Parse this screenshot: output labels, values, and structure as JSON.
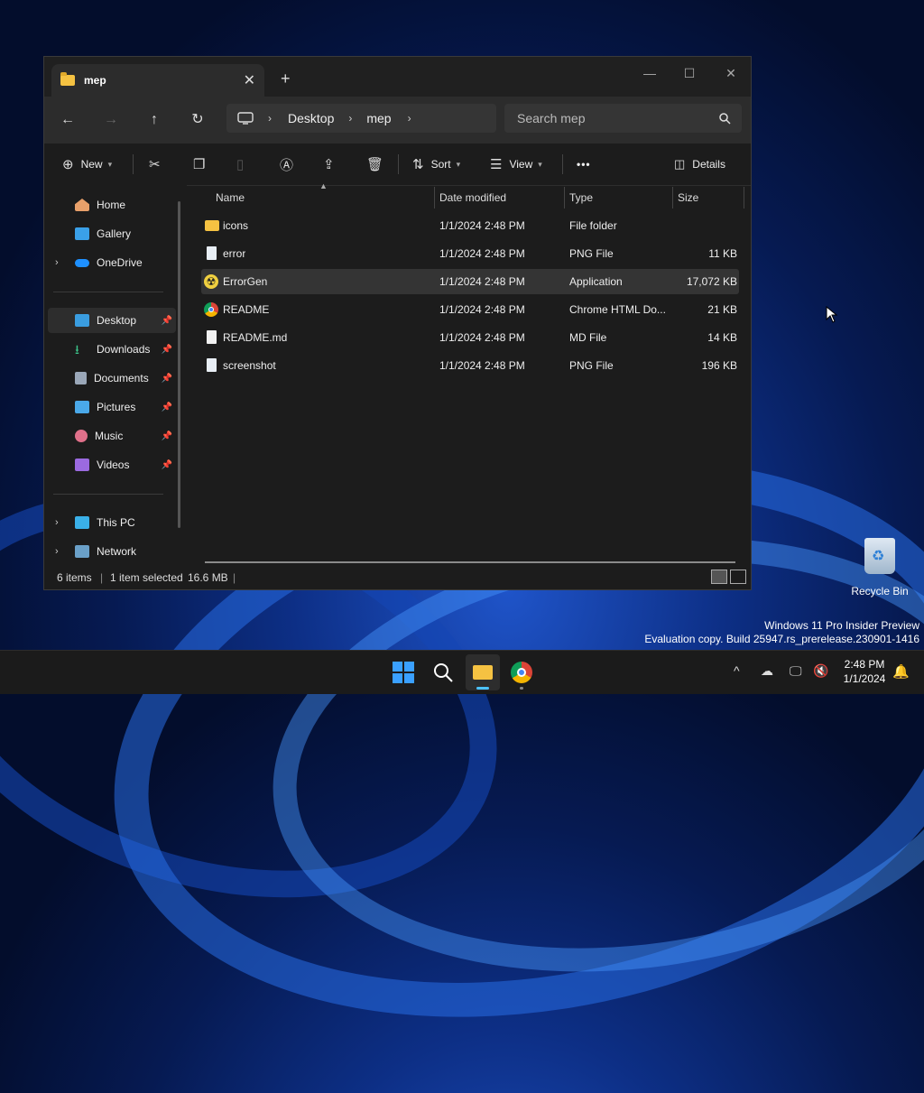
{
  "window": {
    "tab_title": "mep",
    "new_tab": "+",
    "close_tab": "✕",
    "controls": {
      "minimize": "—",
      "maximize": "☐",
      "close": "✕"
    }
  },
  "address": {
    "crumbs": [
      "Desktop",
      "mep"
    ],
    "search_placeholder": "Search mep"
  },
  "commands": {
    "new": "New",
    "sort": "Sort",
    "view": "View",
    "more": "•••",
    "details": "Details"
  },
  "nav": {
    "items": [
      {
        "label": "Home"
      },
      {
        "label": "Gallery"
      },
      {
        "label": "OneDrive"
      },
      {
        "label": "Desktop"
      },
      {
        "label": "Downloads"
      },
      {
        "label": "Documents"
      },
      {
        "label": "Pictures"
      },
      {
        "label": "Music"
      },
      {
        "label": "Videos"
      },
      {
        "label": "This PC"
      },
      {
        "label": "Network"
      }
    ]
  },
  "columns": [
    "Name",
    "Date modified",
    "Type",
    "Size"
  ],
  "files": [
    {
      "name": "icons",
      "date": "1/1/2024 2:48 PM",
      "type": "File folder",
      "size": ""
    },
    {
      "name": "error",
      "date": "1/1/2024 2:48 PM",
      "type": "PNG File",
      "size": "11 KB"
    },
    {
      "name": "ErrorGen",
      "date": "1/1/2024 2:48 PM",
      "type": "Application",
      "size": "17,072 KB"
    },
    {
      "name": "README",
      "date": "1/1/2024 2:48 PM",
      "type": "Chrome HTML Do...",
      "size": "21 KB"
    },
    {
      "name": "README.md",
      "date": "1/1/2024 2:48 PM",
      "type": "MD File",
      "size": "14 KB"
    },
    {
      "name": "screenshot",
      "date": "1/1/2024 2:48 PM",
      "type": "PNG File",
      "size": "196 KB"
    }
  ],
  "status": {
    "count": "6 items",
    "selected": "1 item selected",
    "size": "16.6 MB",
    "sep": "|"
  },
  "desktop": {
    "recycle_bin": "Recycle Bin",
    "watermark_line1": "Windows 11 Pro Insider Preview",
    "watermark_line2": "Evaluation copy. Build 25947.rs_prerelease.230901-1416"
  },
  "taskbar": {
    "time": "2:48 PM",
    "date": "1/1/2024",
    "tray_chevron": "^"
  },
  "colors": {
    "folder": "#f5c242",
    "accent": "#4cc2ff",
    "selected_row": "#343434"
  }
}
